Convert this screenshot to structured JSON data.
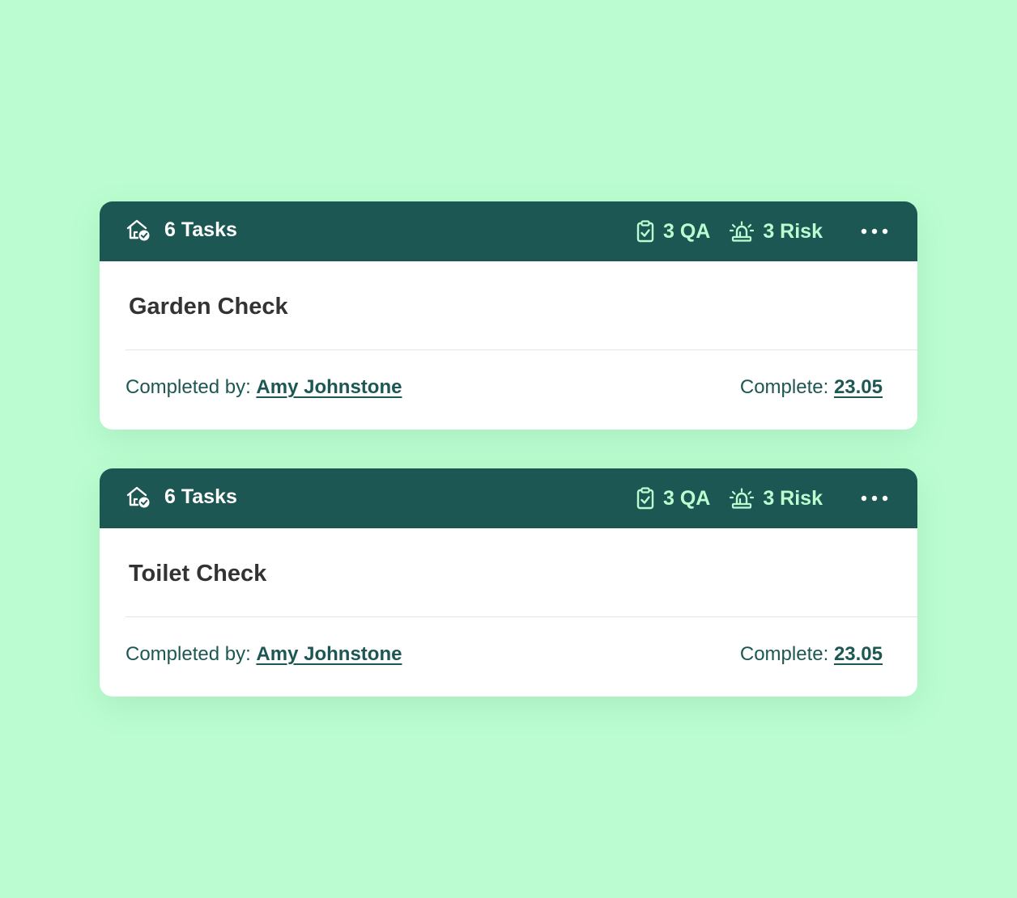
{
  "cards": [
    {
      "tasks_label": "6 Tasks",
      "qa_label": "3 QA",
      "risk_label": "3 Risk",
      "title": "Garden Check",
      "completed_by_label": "Completed by:",
      "completed_by_name": "Amy Johnstone",
      "complete_label": "Complete:",
      "complete_date": "23.05"
    },
    {
      "tasks_label": "6 Tasks",
      "qa_label": "3 QA",
      "risk_label": "3 Risk",
      "title": "Toilet Check",
      "completed_by_label": "Completed by:",
      "completed_by_name": "Amy Johnstone",
      "complete_label": "Complete:",
      "complete_date": "23.05"
    }
  ],
  "icons": {
    "tasks": "home-check-icon",
    "qa": "clipboard-check-icon",
    "risk": "siren-icon",
    "more": "more-dots-icon"
  },
  "colors": {
    "background": "#bbfdd0",
    "header": "#1d5753",
    "accent": "#bbfdd0",
    "title_text": "#333333",
    "footer_text": "#1d5753"
  }
}
